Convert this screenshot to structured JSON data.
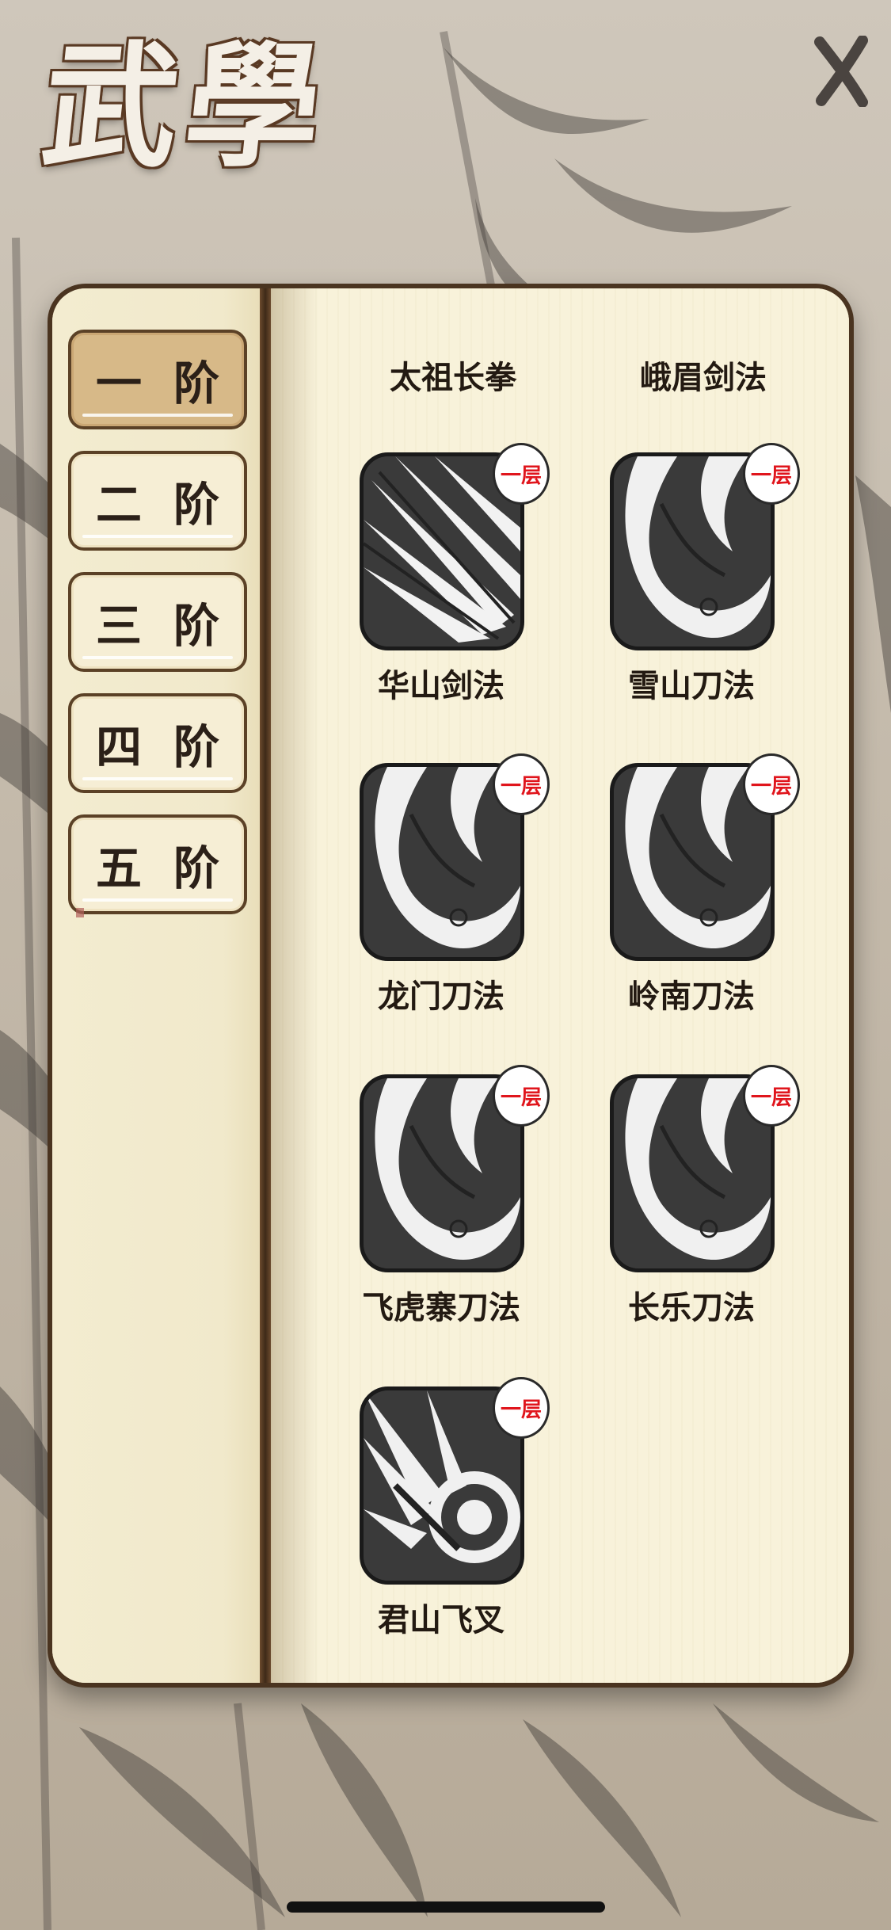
{
  "title": "武學",
  "tiers": [
    {
      "label": "一阶",
      "active": true
    },
    {
      "label": "二阶",
      "active": false
    },
    {
      "label": "三阶",
      "active": false
    },
    {
      "label": "四阶",
      "active": false
    },
    {
      "label": "五阶",
      "active": false
    }
  ],
  "column_headers": [
    "太祖长拳",
    "峨眉剑法"
  ],
  "skills": [
    {
      "name": "华山剑法",
      "badge": "一层",
      "icon": "sword-slash-icon"
    },
    {
      "name": "雪山刀法",
      "badge": "一层",
      "icon": "blade-swirl-icon"
    },
    {
      "name": "龙门刀法",
      "badge": "一层",
      "icon": "blade-swirl-icon"
    },
    {
      "name": "岭南刀法",
      "badge": "一层",
      "icon": "blade-swirl-icon"
    },
    {
      "name": "飞虎寨刀法",
      "badge": "一层",
      "icon": "blade-swirl-icon"
    },
    {
      "name": "长乐刀法",
      "badge": "一层",
      "icon": "blade-swirl-icon"
    },
    {
      "name": "君山飞叉",
      "badge": "一层",
      "icon": "fork-strike-icon"
    }
  ],
  "colors": {
    "accent_tab": "#d7b988",
    "badge_text": "#e0151c",
    "frame": "#4a3420"
  }
}
